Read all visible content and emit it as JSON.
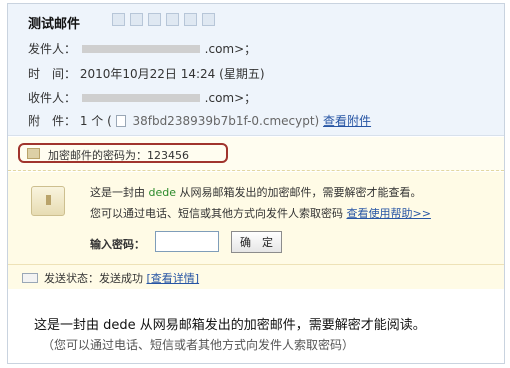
{
  "header": {
    "subject": "测试邮件",
    "from": {
      "label": "发件人：",
      "suffix": ".com>；"
    },
    "time": {
      "label": "时　间：",
      "value": "2010年10月22日 14:24 (星期五)"
    },
    "to": {
      "label": "收件人：",
      "suffix": ".com>；"
    },
    "attachment": {
      "label": "附　件：",
      "count": "1 个 (",
      "filename": "38fbd238939b7b1f-0.cmecypt)",
      "view_link": "查看附件"
    },
    "tool_icons": [
      "flag-icon",
      "forward-icon",
      "compose-icon",
      "print-icon",
      "top-icon",
      "collapse-icon"
    ]
  },
  "password_hint": {
    "text": "加密邮件的密码为：123456"
  },
  "encrypted_box": {
    "line1_prefix": "这是一封由",
    "line1_sender": "dede",
    "line1_suffix": "从网易邮箱发出的加密邮件，需要解密才能查看。",
    "line2": "您可以通过电话、短信或其他方式向发件人索取密码",
    "help_link": "查看使用帮助>>",
    "password_label": "输入密码：",
    "confirm_button": "确　定"
  },
  "status": {
    "label": "发送状态：发送成功",
    "details_link": "[查看详情]"
  },
  "body": {
    "line1": "这是一封由 dede 从网易邮箱发出的加密邮件，需要解密才能阅读。",
    "line2": "（您可以通过电话、短信或者其他方式向发件人索取密码）"
  },
  "colors": {
    "header_bg": "#eef4fb",
    "box_bg": "#fffbe6",
    "highlight_border": "#a0342d",
    "link": "#2755a4",
    "green": "#2b8a2b"
  }
}
